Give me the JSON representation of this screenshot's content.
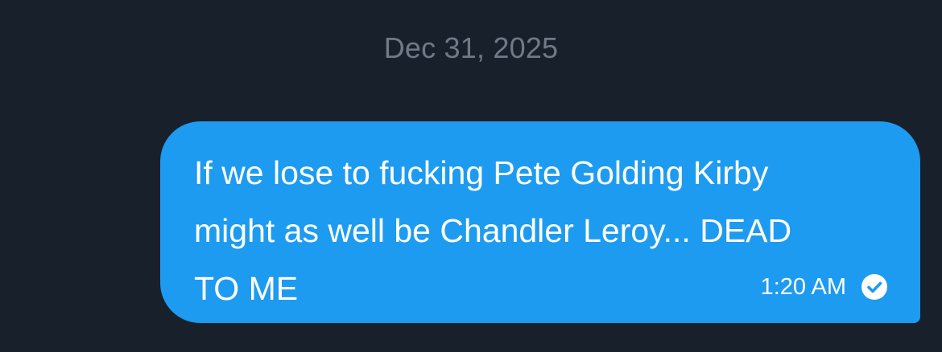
{
  "conversation": {
    "date_separator": "Dec 31, 2025",
    "messages": [
      {
        "text": "If we lose to fucking Pete Golding Kirby\nmight as well be Chandler Leroy... DEAD\nTO ME",
        "time": "1:20 AM",
        "status_icon": "read-check-icon"
      }
    ]
  },
  "colors": {
    "background": "#18202b",
    "bubble": "#1d9bf0",
    "date_text": "#6f7a86",
    "message_text": "#ffffff"
  }
}
